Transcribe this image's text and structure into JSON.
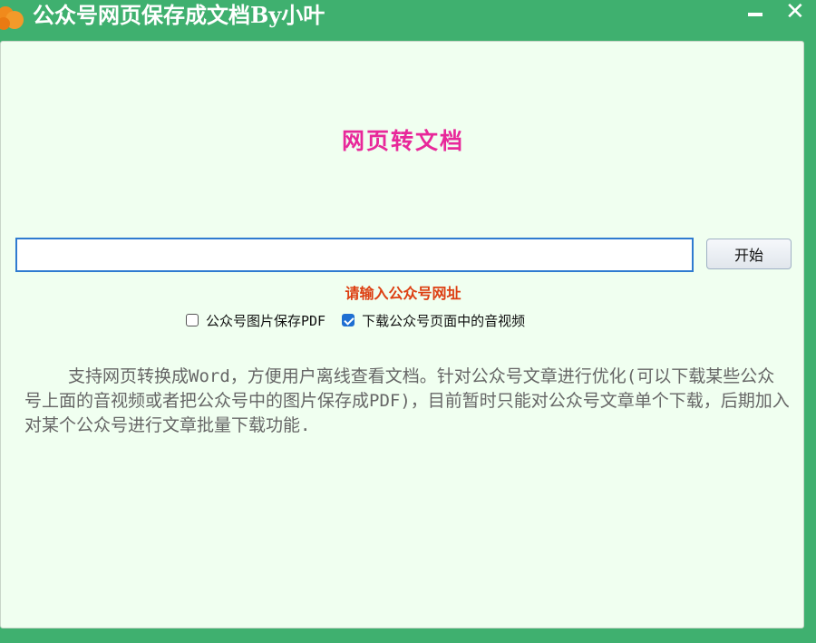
{
  "window": {
    "title": "公众号网页保存成文档By小叶",
    "minimize_label": "minimize",
    "close_label": "close"
  },
  "main": {
    "heading": "网页转文档",
    "url_input": {
      "value": "",
      "placeholder": ""
    },
    "start_button_label": "开始",
    "hint": "请输入公众号网址",
    "options": [
      {
        "label": "公众号图片保存PDF",
        "checked": false
      },
      {
        "label": "下载公众号页面中的音视频",
        "checked": true
      }
    ],
    "description": "支持网页转换成Word，方便用户离线查看文档。针对公众号文章进行优化(可以下载某些公众号上面的音视频或者把公众号中的图片保存成PDF)，目前暂时只能对公众号文章单个下载，后期加入对某个公众号进行文章批量下载功能."
  },
  "colors": {
    "titlebar": "#3fb06f",
    "client_bg": "#f0fff0",
    "heading": "#e8289a",
    "hint": "#dd3f12",
    "input_border": "#2f7bd0",
    "checkbox_checked": "#1f6fd2",
    "description_text": "#666666"
  },
  "icons": {
    "app": "orange-app-icon",
    "minimize": "minimize-icon",
    "close": "close-icon",
    "checkbox_checked": "checkmark-icon"
  }
}
